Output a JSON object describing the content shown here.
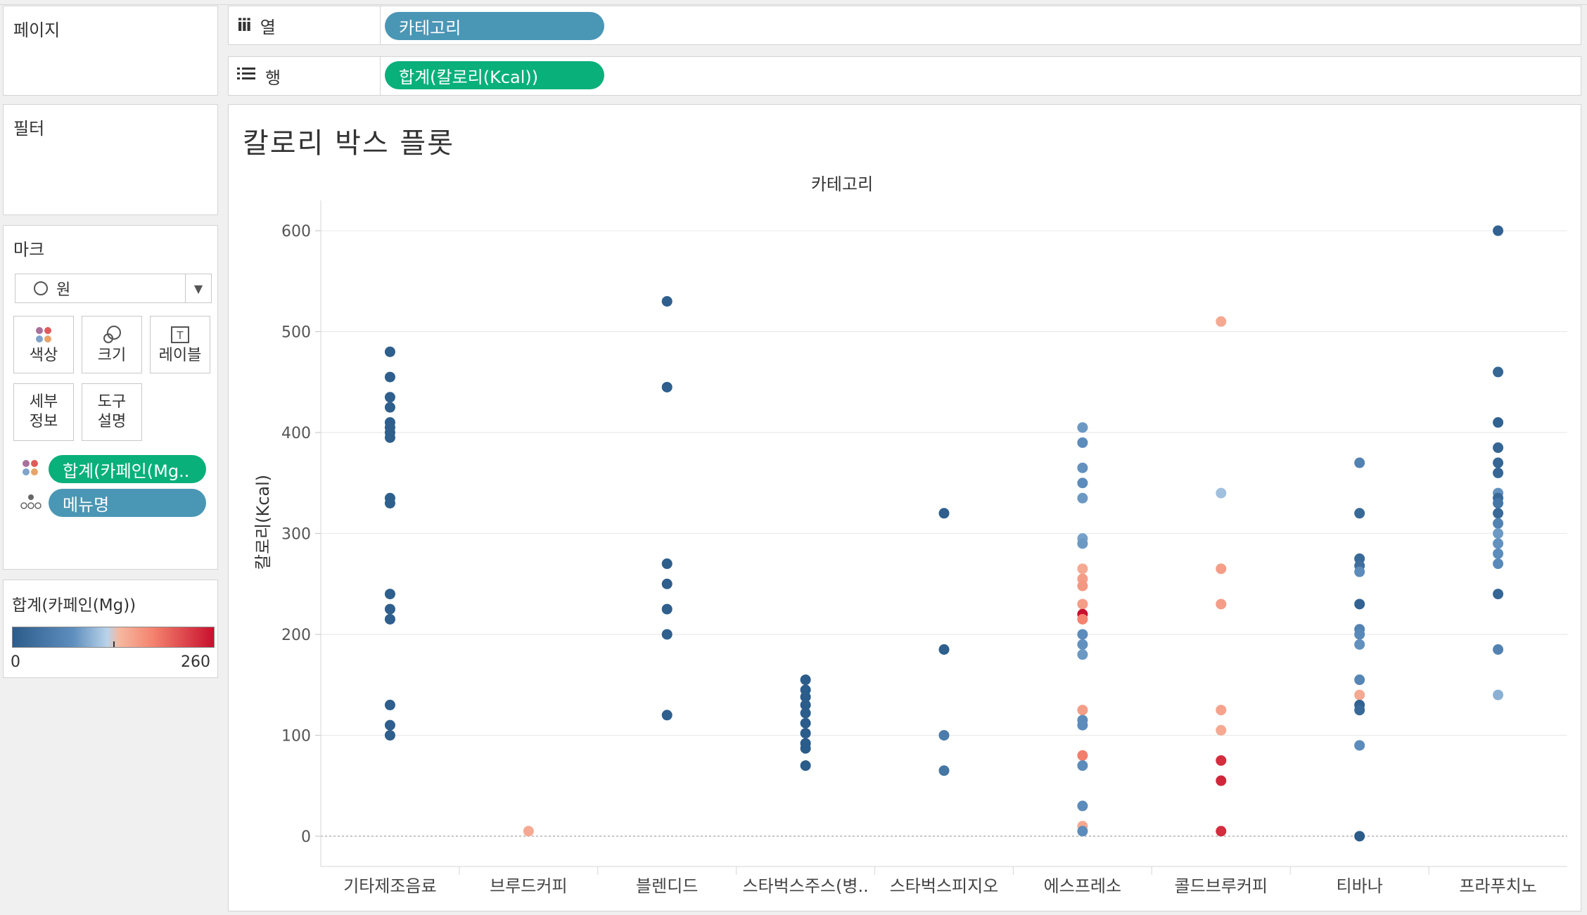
{
  "left": {
    "pages_title": "페이지",
    "filters_title": "필터",
    "marks": {
      "title": "마크",
      "mark_type": "원",
      "cards": {
        "color": "색상",
        "size": "크기",
        "label": "레이블",
        "detail": "세부\n정보",
        "tooltip": "도구\n설명"
      },
      "pills": {
        "color_field": "합계(카페인(Mg..",
        "detail_field": "메뉴명"
      }
    },
    "color_legend": {
      "title": "합계(카페인(Mg))",
      "min": "0",
      "max": "260"
    }
  },
  "shelves": {
    "columns": {
      "label": "열",
      "pill": "카테고리"
    },
    "rows": {
      "label": "행",
      "pill": "합계(칼로리(Kcal))"
    }
  },
  "sheet": {
    "title": "칼로리 박스 플롯"
  },
  "colors": {
    "teal_pill": "#4a96b5",
    "green_pill": "#09b07a",
    "low": "#2b5c8a",
    "high": "#c8102e"
  },
  "chart_data": {
    "type": "scatter",
    "title": "칼로리 박스 플롯",
    "xlabel": "카테고리",
    "ylabel": "칼로리(Kcal)",
    "ylim": [
      -30,
      630
    ],
    "yticks": [
      0,
      100,
      200,
      300,
      400,
      500,
      600
    ],
    "caffeine_range": [
      0,
      260
    ],
    "categories": [
      "기타제조음료",
      "브루드커피",
      "블렌디드",
      "스타벅스주스(병..",
      "스타벅스피지오",
      "에스프레소",
      "콜드브루커피",
      "티바나",
      "프라푸치노"
    ],
    "series": [
      {
        "category": "기타제조음료",
        "points": [
          [
            480,
            5
          ],
          [
            455,
            5
          ],
          [
            435,
            5
          ],
          [
            425,
            5
          ],
          [
            410,
            5
          ],
          [
            405,
            5
          ],
          [
            400,
            5
          ],
          [
            395,
            5
          ],
          [
            335,
            5
          ],
          [
            330,
            5
          ],
          [
            240,
            5
          ],
          [
            225,
            5
          ],
          [
            215,
            5
          ],
          [
            130,
            5
          ],
          [
            110,
            5
          ],
          [
            100,
            5
          ]
        ]
      },
      {
        "category": "브루드커피",
        "points": [
          [
            5,
            150
          ]
        ]
      },
      {
        "category": "블렌디드",
        "points": [
          [
            530,
            5
          ],
          [
            445,
            5
          ],
          [
            270,
            5
          ],
          [
            250,
            5
          ],
          [
            225,
            5
          ],
          [
            200,
            5
          ],
          [
            120,
            5
          ]
        ]
      },
      {
        "category": "스타벅스주스(병..",
        "points": [
          [
            155,
            0
          ],
          [
            145,
            0
          ],
          [
            138,
            0
          ],
          [
            130,
            0
          ],
          [
            122,
            0
          ],
          [
            112,
            0
          ],
          [
            102,
            0
          ],
          [
            92,
            0
          ],
          [
            87,
            0
          ],
          [
            70,
            0
          ]
        ]
      },
      {
        "category": "스타벅스피지오",
        "points": [
          [
            320,
            5
          ],
          [
            185,
            5
          ],
          [
            100,
            50
          ],
          [
            65,
            40
          ]
        ]
      },
      {
        "category": "에스프레소",
        "points": [
          [
            405,
            85
          ],
          [
            390,
            75
          ],
          [
            365,
            80
          ],
          [
            350,
            75
          ],
          [
            335,
            85
          ],
          [
            295,
            90
          ],
          [
            290,
            85
          ],
          [
            265,
            150
          ],
          [
            255,
            160
          ],
          [
            248,
            165
          ],
          [
            230,
            160
          ],
          [
            220,
            260
          ],
          [
            215,
            180
          ],
          [
            200,
            75
          ],
          [
            190,
            80
          ],
          [
            180,
            85
          ],
          [
            125,
            160
          ],
          [
            115,
            75
          ],
          [
            110,
            75
          ],
          [
            80,
            185
          ],
          [
            70,
            75
          ],
          [
            30,
            75
          ],
          [
            10,
            150
          ],
          [
            5,
            75
          ]
        ]
      },
      {
        "category": "콜드브루커피",
        "points": [
          [
            510,
            150
          ],
          [
            340,
            110
          ],
          [
            265,
            160
          ],
          [
            230,
            160
          ],
          [
            125,
            155
          ],
          [
            105,
            150
          ],
          [
            75,
            240
          ],
          [
            55,
            245
          ],
          [
            5,
            240
          ]
        ]
      },
      {
        "category": "티바나",
        "points": [
          [
            370,
            60
          ],
          [
            320,
            20
          ],
          [
            275,
            20
          ],
          [
            268,
            30
          ],
          [
            262,
            75
          ],
          [
            230,
            10
          ],
          [
            205,
            60
          ],
          [
            200,
            70
          ],
          [
            190,
            80
          ],
          [
            155,
            65
          ],
          [
            140,
            150
          ],
          [
            130,
            10
          ],
          [
            125,
            20
          ],
          [
            90,
            75
          ],
          [
            0,
            0
          ]
        ]
      },
      {
        "category": "프라푸치노",
        "points": [
          [
            600,
            10
          ],
          [
            460,
            15
          ],
          [
            410,
            10
          ],
          [
            385,
            15
          ],
          [
            370,
            15
          ],
          [
            360,
            15
          ],
          [
            340,
            80
          ],
          [
            335,
            20
          ],
          [
            330,
            40
          ],
          [
            320,
            20
          ],
          [
            310,
            60
          ],
          [
            300,
            85
          ],
          [
            290,
            80
          ],
          [
            280,
            75
          ],
          [
            270,
            70
          ],
          [
            240,
            15
          ],
          [
            185,
            60
          ],
          [
            140,
            100
          ]
        ]
      }
    ]
  }
}
